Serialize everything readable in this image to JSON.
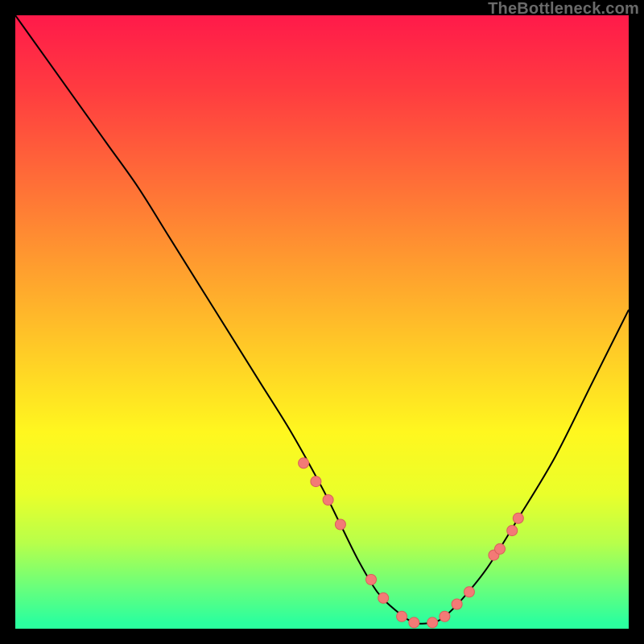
{
  "watermark": "TheBottleneck.com",
  "colors": {
    "page_bg": "#000000",
    "gradient_top": "#ff1a4a",
    "gradient_bottom": "#2bff9e",
    "curve": "#000000",
    "dot_fill": "#f37a76",
    "dot_stroke": "#d85f5b"
  },
  "chart_data": {
    "type": "line",
    "title": "",
    "xlabel": "",
    "ylabel": "",
    "xlim": [
      0,
      100
    ],
    "ylim": [
      0,
      100
    ],
    "grid": false,
    "legend": false,
    "series": [
      {
        "name": "bottleneck-curve",
        "x": [
          0,
          5,
          10,
          15,
          20,
          25,
          30,
          35,
          40,
          45,
          50,
          53,
          56,
          59,
          62,
          65,
          68,
          70,
          73,
          77,
          82,
          88,
          94,
          100
        ],
        "values": [
          100,
          93,
          86,
          79,
          72,
          64,
          56,
          48,
          40,
          32,
          23,
          17,
          11,
          6,
          3,
          1,
          1,
          2,
          5,
          10,
          18,
          28,
          40,
          52
        ]
      }
    ],
    "dots": {
      "name": "highlight-points",
      "x": [
        47,
        49,
        51,
        53,
        58,
        60,
        63,
        65,
        68,
        70,
        72,
        74,
        78,
        79,
        81,
        82
      ],
      "values": [
        27,
        24,
        21,
        17,
        8,
        5,
        2,
        1,
        1,
        2,
        4,
        6,
        12,
        13,
        16,
        18
      ]
    }
  }
}
